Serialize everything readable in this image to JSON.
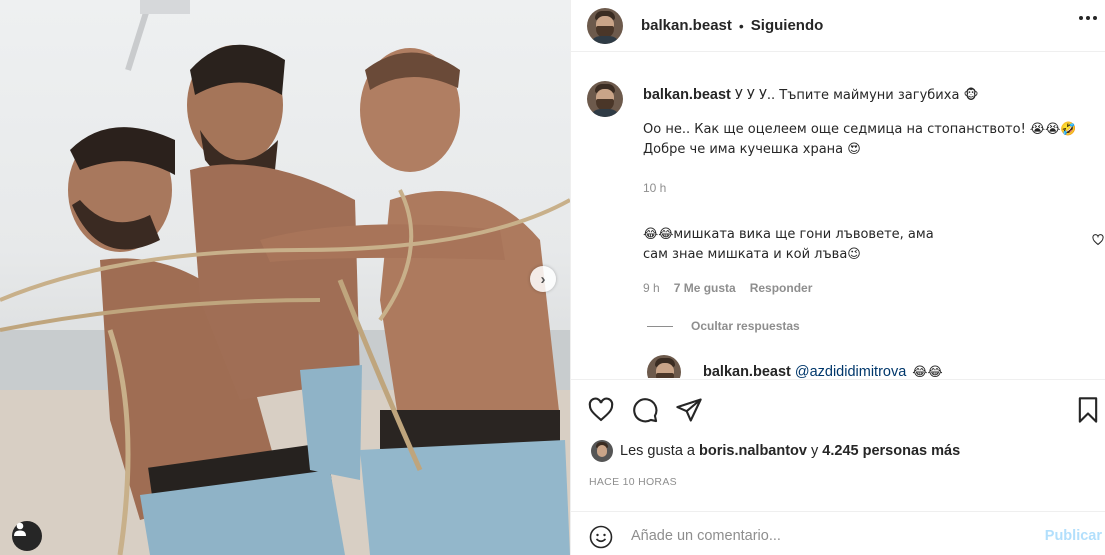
{
  "post": {
    "author": "balkan.beast",
    "separator": "•",
    "follow_status": "Siguiendo",
    "more_icon": "more-horizontal-icon"
  },
  "caption": {
    "author": "balkan.beast",
    "line1": "У У У.. Тъпите маймуни загубиха 🐵",
    "line2": "Оо не.. Как ще оцелеем още седмица на стопанството! 😭😭🤣",
    "line3": "Добре че има кучешка храна 😍",
    "time": "10 h"
  },
  "reply": {
    "text_line1": "😂😂мишката вика ще гони лъвовете, ама",
    "text_line2": "сам знае мишката и кой лъва😉",
    "time": "9 h",
    "likes": "7 Me gusta",
    "answer": "Responder",
    "hide_replies": "Ocultar respuestas"
  },
  "nested_reply": {
    "author": "balkan.beast",
    "mention": "@azdididimitrova",
    "emoji": "😂😂"
  },
  "likes": {
    "prefix": "Les gusta a",
    "user": "boris.nalbantov",
    "conj": "y",
    "others": "4.245 personas más"
  },
  "timestamp": "HACE 10 HORAS",
  "comment_box": {
    "placeholder": "Añade un comentario...",
    "publish": "Publicar"
  },
  "colors": {
    "text": "#262626",
    "muted": "#8e8e8e",
    "link": "#00376b",
    "publish_disabled": "#b2dffc",
    "border": "#efefef"
  }
}
